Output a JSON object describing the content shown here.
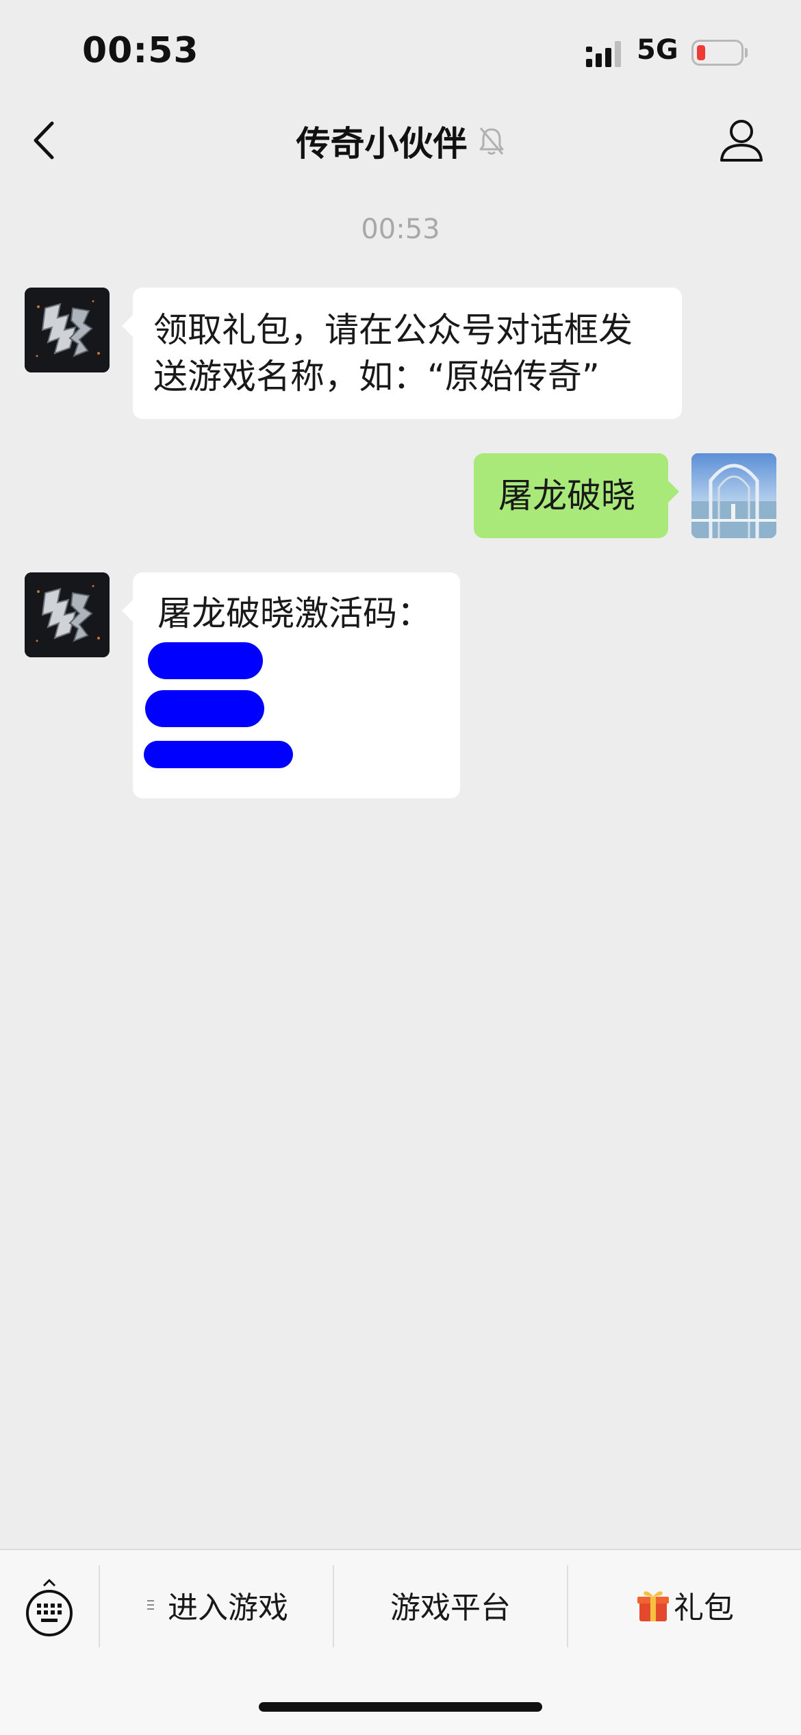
{
  "status_bar": {
    "time": "00:53",
    "network": "5G"
  },
  "nav": {
    "title": "传奇小伙伴"
  },
  "chat": {
    "timestamp": "00:53",
    "messages": [
      {
        "from": "official_account",
        "text_line1": "领取礼包，请在公众号对话框发",
        "text_line2": "送游戏名称，如：“原始传奇”"
      },
      {
        "from": "me",
        "text": "屠龙破晓"
      },
      {
        "from": "official_account",
        "text": "屠龙破晓激活码："
      }
    ]
  },
  "bottom_menu": {
    "items": [
      {
        "label": "进入游戏",
        "icon": "list-icon"
      },
      {
        "label": "游戏平台"
      },
      {
        "label": "礼包",
        "icon": "gift-icon"
      }
    ]
  },
  "colors": {
    "background": "#ededed",
    "my_bubble": "#a9e97a",
    "other_bubble": "#ffffff",
    "battery_low": "#f03a35",
    "redaction": "#0000ff"
  }
}
